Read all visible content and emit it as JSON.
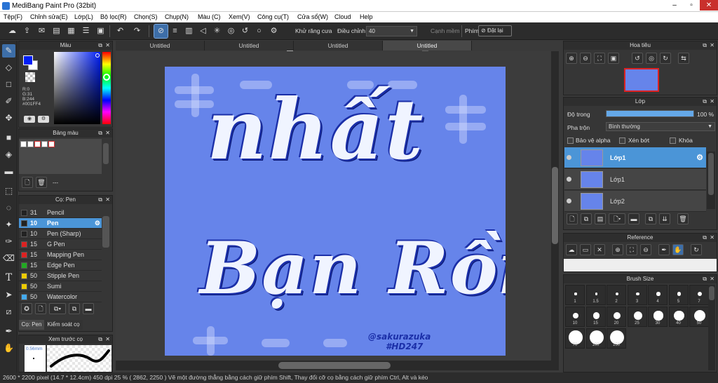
{
  "window": {
    "title": "MediBang Paint Pro (32bit)"
  },
  "menu": [
    "Tệp(F)",
    "Chỉnh sửa(E)",
    "Lớp(L)",
    "Bộ lọc(R)",
    "Chọn(S)",
    "Chụp(N)",
    "Màu (C)",
    "Xem(V)",
    "Công cụ(T)",
    "Cửa sổ(W)",
    "Cloud",
    "Help"
  ],
  "toolbar": {
    "antialias_label": "Khử răng cưa",
    "stabilizer_label": "Điều chỉnh",
    "stabilizer_value": "40",
    "smooth_label": "Cạnh mềm",
    "key_label": "Phím",
    "reset_label": "Đặt lại"
  },
  "doc_tabs": [
    "Untitled",
    "Untitled",
    "Untitled",
    "Untitled"
  ],
  "color_panel": {
    "title": "Màu",
    "r": "R:0",
    "g": "G:31",
    "b": "B:244",
    "hex": "#001FF4",
    "fg": "#001ff4"
  },
  "palette_panel": {
    "title": "Bảng màu",
    "placeholder": "---"
  },
  "brush_panel": {
    "title": "Cọ: Pen",
    "items": [
      {
        "size": "31",
        "name": "Pencil",
        "color": "#222222"
      },
      {
        "size": "10",
        "name": "Pen",
        "color": "#222222"
      },
      {
        "size": "10",
        "name": "Pen (Sharp)",
        "color": "#222222"
      },
      {
        "size": "15",
        "name": "G Pen",
        "color": "#dd2222"
      },
      {
        "size": "15",
        "name": "Mapping Pen",
        "color": "#dd2222"
      },
      {
        "size": "15",
        "name": "Edge Pen",
        "color": "#22aa22"
      },
      {
        "size": "50",
        "name": "Stipple Pen",
        "color": "#eecc00"
      },
      {
        "size": "50",
        "name": "Sumi",
        "color": "#eecc00"
      },
      {
        "size": "50",
        "name": "Watercolor",
        "color": "#44aaee"
      }
    ],
    "tab1": "Cọ: Pen",
    "tab2": "Kiểm soát cọ"
  },
  "preview_panel": {
    "title": "Xem trước cọ",
    "size": "0.56mm"
  },
  "navigator_panel": {
    "title": "Hoa tiêu"
  },
  "layer_panel": {
    "title": "Lớp",
    "opacity_label": "Độ trong",
    "opacity_value": "100 %",
    "opacity_fraction": 1.0,
    "blend_label": "Pha trộn",
    "blend_value": "Bình thường",
    "protect_alpha": "Bảo vệ alpha",
    "clipping": "Xén bớt",
    "lock": "Khóa",
    "layers": [
      {
        "name": "Lớp1"
      },
      {
        "name": "Lớp1"
      },
      {
        "name": "Lớp2"
      }
    ]
  },
  "reference_panel": {
    "title": "Reference"
  },
  "brushsize_panel": {
    "title": "Brush Size",
    "sizes": [
      "1",
      "1.5",
      "2",
      "3",
      "4",
      "5",
      "7",
      "10",
      "15",
      "20",
      "25",
      "30",
      "40",
      "50",
      "70",
      "100",
      "150"
    ]
  },
  "artwork": {
    "line1": "nhất",
    "line2": "Bạn Rồi",
    "sig1": "@sakurazuka",
    "sig2": "#HD247",
    "bg": "#6684ea"
  },
  "status": {
    "text": "2600 * 2200 pixel   (14.7 * 12.4cm)   450 dpi   25 %   ( 2862, 2250 )  Vẽ một đường thẳng bằng cách giữ phím Shift, Thay đổi cỡ cọ bằng cách giữ phím Ctrl, Alt và kéo"
  }
}
